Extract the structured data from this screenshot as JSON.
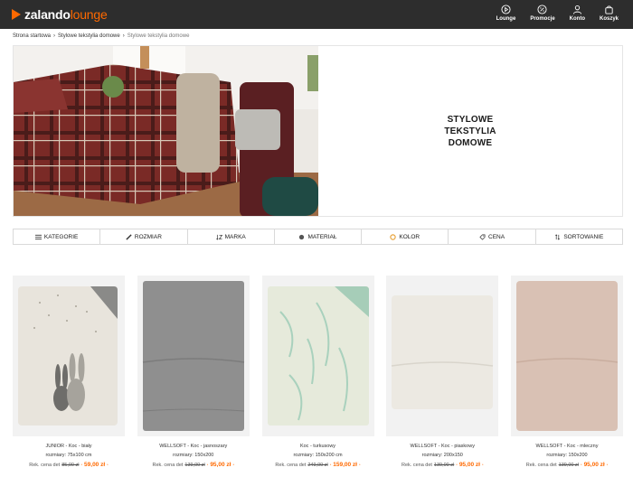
{
  "brand": {
    "name_main": "zalando",
    "name_lounge": "lounge",
    "accent": "#ff6900"
  },
  "nav": [
    {
      "label": "Lounge",
      "icon": "play-circle-icon"
    },
    {
      "label": "Promocje",
      "icon": "percent-circle-icon"
    },
    {
      "label": "Konto",
      "icon": "user-icon"
    },
    {
      "label": "Koszyk",
      "icon": "shopping-bag-icon"
    }
  ],
  "breadcrumb": {
    "home": "Strona startowa",
    "category": "Stylowe tekstylia domowe",
    "current": "Stylowe tekstylia domowe"
  },
  "hero": {
    "title": "STYLOWE\nTEKSTYLIA\nDOMOWE"
  },
  "filters": [
    {
      "label": "KATEGORIE",
      "icon": "menu-icon"
    },
    {
      "label": "ROZMIAR",
      "icon": "ruler-icon"
    },
    {
      "label": "MARKA",
      "icon": "sort-az-icon"
    },
    {
      "label": "MATERIAŁ",
      "icon": "circle-icon"
    },
    {
      "label": "KOLOR",
      "icon": "color-circle-icon"
    },
    {
      "label": "CENA",
      "icon": "tag-icon"
    },
    {
      "label": "SORTOWANIE",
      "icon": "sort-arrows-icon"
    }
  ],
  "products": [
    {
      "name": "JUNIOR - Koc - biały",
      "size": "rozmiary: 75x100 cm",
      "old_label": "Rek. cena det",
      "old_price": "85,00 zł",
      "price": "59,00 zł",
      "colors": {
        "bg": "#eeeae3",
        "main": "#dcd8ce"
      }
    },
    {
      "name": "WELLSOFT - Koc - jasnoszary",
      "size": "rozmiary: 150x200",
      "old_label": "Rek. cena det",
      "old_price": "139,00 zł",
      "price": "95,00 zł",
      "colors": {
        "bg": "#eaeaea",
        "main": "#8f8f8f"
      }
    },
    {
      "name": "Koc - turkusowy",
      "size": "rozmiary: 150x200 cm",
      "old_label": "Rek. cena det",
      "old_price": "249,00 zł",
      "price": "159,00 zł",
      "colors": {
        "bg": "#eaeaea",
        "main": "#e6eadb"
      }
    },
    {
      "name": "WELLSOFT - Koc - piaskowy",
      "size": "rozmiary: 200x150",
      "old_label": "Rek. cena det",
      "old_price": "139,00 zł",
      "price": "95,00 zł",
      "colors": {
        "bg": "#eaeaea",
        "main": "#ece9e2"
      }
    },
    {
      "name": "WELLSOFT - Koc - mleczny",
      "size": "rozmiary: 150x200",
      "old_label": "Rek. cena det",
      "old_price": "139,00 zł",
      "price": "95,00 zł",
      "colors": {
        "bg": "#eaeaea",
        "main": "#d9c1b4"
      }
    }
  ]
}
